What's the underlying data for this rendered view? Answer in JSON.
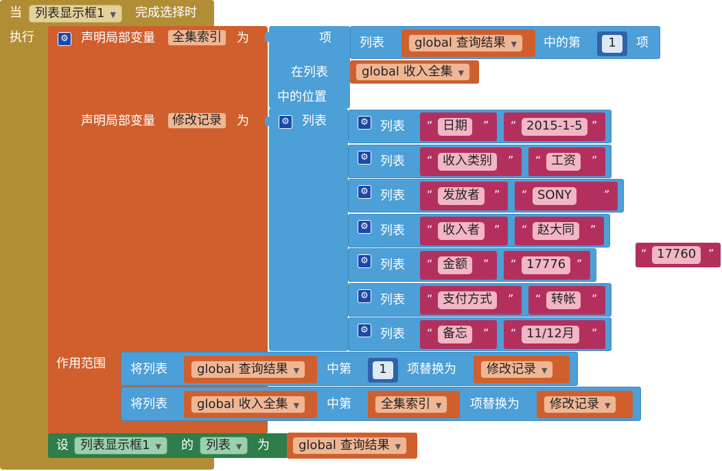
{
  "event": {
    "when": "当",
    "component": "列表显示框1",
    "event_name": "完成选择时",
    "do": "执行"
  },
  "local1": {
    "label": "声明局部变量",
    "var": "全集索引",
    "as": "为"
  },
  "index_block": {
    "item": "项",
    "in_list": "在列表",
    "position": "中的位置"
  },
  "select_block": {
    "list_label": "列表",
    "list_var": "global 查询结果",
    "nth": "中的第",
    "index": "1",
    "item": "项"
  },
  "income_set": {
    "var": "global 收入全集"
  },
  "local2": {
    "label": "声明局部变量",
    "var": "修改记录",
    "as": "为"
  },
  "make_list": {
    "label": "列表"
  },
  "rows": [
    {
      "label": "列表",
      "key": "日期",
      "value": "2015-1-5"
    },
    {
      "label": "列表",
      "key": "收入类别",
      "value": "工资"
    },
    {
      "label": "列表",
      "key": "发放者",
      "value": "SONY"
    },
    {
      "label": "列表",
      "key": "收入者",
      "value": "赵大同"
    },
    {
      "label": "列表",
      "key": "金额",
      "value": "17776"
    },
    {
      "label": "列表",
      "key": "支付方式",
      "value": "转帐"
    },
    {
      "label": "列表",
      "key": "备忘",
      "value": "11/12月"
    }
  ],
  "loose_string": "17760",
  "scope": {
    "label": "作用范围"
  },
  "replace1": {
    "prefix": "将列表",
    "list_var": "global 查询结果",
    "nth": "中第",
    "index": "1",
    "suffix": "项替换为",
    "value_var": "修改记录"
  },
  "replace2": {
    "prefix": "将列表",
    "list_var": "global 收入全集",
    "nth": "中第",
    "index_var": "全集索引",
    "suffix": "项替换为",
    "value_var": "修改记录"
  },
  "set_block": {
    "set": "设",
    "component": "列表显示框1",
    "of": "的",
    "property": "列表",
    "as": "为",
    "value_var": "global 查询结果"
  },
  "colors": {
    "event": "#b18e35",
    "local": "#d05f2d",
    "list": "#4c9fd7",
    "text": "#b3305e",
    "math": "#2f63a8",
    "set": "#2e7d4a"
  },
  "icons": {
    "mutator": "gear-icon",
    "dropdown": "chevron-down-icon"
  }
}
